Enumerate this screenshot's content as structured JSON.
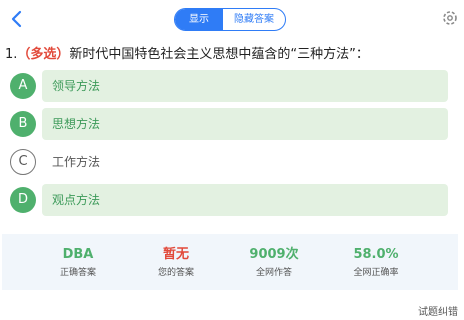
{
  "header": {
    "toggle_show": "显示",
    "toggle_hide": "隐藏答案"
  },
  "question": {
    "number": "1.",
    "type_tag": "（多选）",
    "text": "新时代中国特色社会主义思想中蕴含的“三种方法”："
  },
  "options": [
    {
      "letter": "A",
      "text": "领导方法",
      "correct": true
    },
    {
      "letter": "B",
      "text": "思想方法",
      "correct": true
    },
    {
      "letter": "C",
      "text": "工作方法",
      "correct": false
    },
    {
      "letter": "D",
      "text": "观点方法",
      "correct": true
    }
  ],
  "stats": {
    "correct_answer": {
      "value": "DBA",
      "label": "正确答案"
    },
    "your_answer": {
      "value": "暂无",
      "label": "您的答案"
    },
    "attempts": {
      "value": "9009次",
      "label": "全网作答"
    },
    "accuracy": {
      "value": "58.0%",
      "label": "全网正确率"
    }
  },
  "footer": {
    "report_label": "试题纠错"
  },
  "colors": {
    "accent": "#2f7cf6",
    "correct": "#4fb06d",
    "wrong": "#e24a3b"
  }
}
